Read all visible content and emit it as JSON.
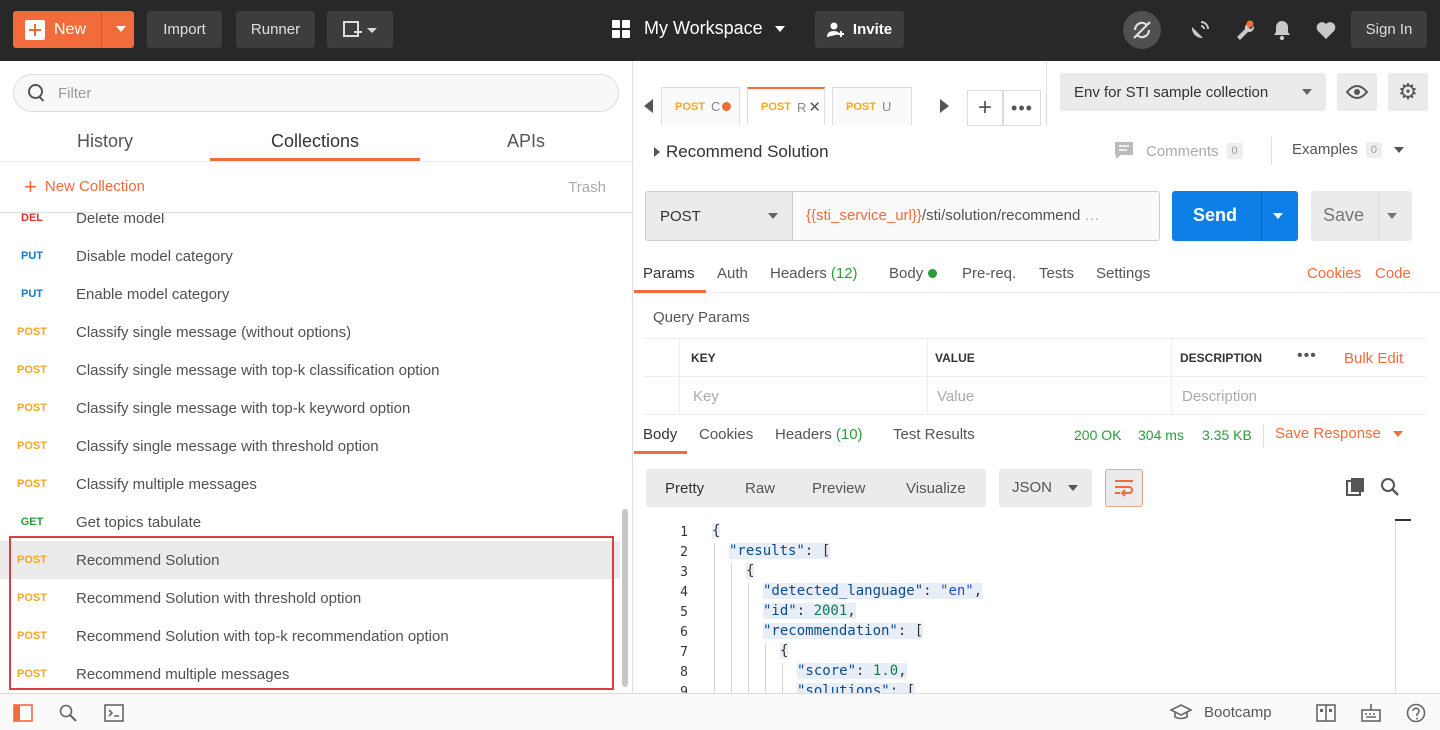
{
  "topbar": {
    "new_label": "New",
    "import_label": "Import",
    "runner_label": "Runner",
    "workspace_label": "My Workspace",
    "invite_label": "Invite",
    "signin_label": "Sign In"
  },
  "sidebar": {
    "filter_placeholder": "Filter",
    "tabs": [
      "History",
      "Collections",
      "APIs"
    ],
    "new_collection_label": "New Collection",
    "trash_label": "Trash",
    "requests": [
      {
        "method": "DEL",
        "name": "Delete model"
      },
      {
        "method": "PUT",
        "name": "Disable model category"
      },
      {
        "method": "PUT",
        "name": "Enable model category"
      },
      {
        "method": "POST",
        "name": "Classify single message (without options)"
      },
      {
        "method": "POST",
        "name": "Classify single message with top-k classification option"
      },
      {
        "method": "POST",
        "name": "Classify single message with top-k keyword option"
      },
      {
        "method": "POST",
        "name": "Classify single message with threshold option"
      },
      {
        "method": "POST",
        "name": "Classify multiple messages"
      },
      {
        "method": "GET",
        "name": "Get topics tabulate"
      },
      {
        "method": "POST",
        "name": "Recommend Solution"
      },
      {
        "method": "POST",
        "name": "Recommend Solution with threshold option"
      },
      {
        "method": "POST",
        "name": "Recommend Solution with top-k recommendation option"
      },
      {
        "method": "POST",
        "name": "Recommend multiple messages"
      }
    ]
  },
  "tabs": [
    {
      "method": "POST",
      "name": "C"
    },
    {
      "method": "POST",
      "name": "R"
    },
    {
      "method": "POST",
      "name": "U"
    }
  ],
  "environment": {
    "selected": "Env for STI sample collection"
  },
  "request": {
    "name": "Recommend Solution",
    "comments_label": "Comments",
    "comments_count": "0",
    "examples_label": "Examples",
    "examples_count": "0",
    "method": "POST",
    "url_var": "{{sti_service_url}}",
    "url_path": "/sti/solution/recommend",
    "url_ellipsis": "…",
    "send_label": "Send",
    "save_label": "Save",
    "tabs": {
      "params": "Params",
      "auth": "Auth",
      "headers": "Headers",
      "headers_count": "(12)",
      "body": "Body",
      "prereq": "Pre-req.",
      "tests": "Tests",
      "settings": "Settings",
      "cookies": "Cookies",
      "code": "Code"
    },
    "query_params": {
      "title": "Query Params",
      "headers": [
        "KEY",
        "VALUE",
        "DESCRIPTION"
      ],
      "placeholders": [
        "Key",
        "Value",
        "Description"
      ],
      "bulk_edit": "Bulk Edit"
    }
  },
  "response": {
    "tabs": {
      "body": "Body",
      "cookies": "Cookies",
      "headers": "Headers",
      "headers_count": "(10)",
      "tests": "Test Results"
    },
    "status": "200 OK",
    "time": "304 ms",
    "size": "3.35 KB",
    "save_label": "Save Response",
    "formats": [
      "Pretty",
      "Raw",
      "Preview",
      "Visualize"
    ],
    "language": "JSON",
    "lines": [
      "1",
      "2",
      "3",
      "4",
      "5",
      "6",
      "7",
      "8",
      "9"
    ]
  },
  "statusbar": {
    "bootcamp_label": "Bootcamp"
  }
}
